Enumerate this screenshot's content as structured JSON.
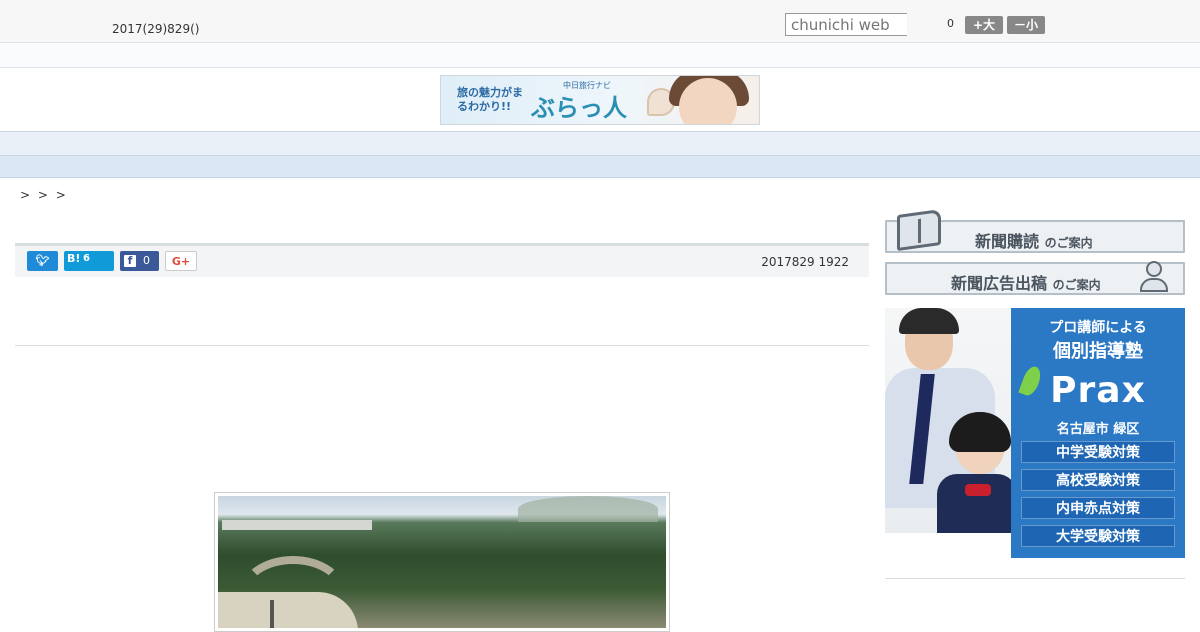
{
  "header": {
    "date": "2017(29)829()",
    "search_placeholder": "chunichi web",
    "counter": "0",
    "font_bigger": "+大",
    "font_smaller": "－小"
  },
  "banner": {
    "tagline": "旅の魅力がまるわかり!!",
    "subtitle": "中日旅行ナビ",
    "brand": "ぶらっ人"
  },
  "nav": {
    "items": [
      "　　",
      "　　",
      "　　",
      "　　",
      "　　",
      "　　",
      "　　",
      "　　",
      "　　"
    ]
  },
  "breadcrumb": "> > >",
  "share": {
    "hatena_icon": "B!",
    "hatena_count": "6",
    "facebook_count": "0",
    "google_plus": "G+"
  },
  "article": {
    "published": "2017829 1922"
  },
  "sidebar": {
    "subscribe": {
      "main": "新聞購読",
      "sub": "のご案内"
    },
    "advertise": {
      "main": "新聞広告出稿",
      "sub": "のご案内"
    },
    "ad": {
      "line1": "プロ講師による",
      "line2": "個別指導塾",
      "logo": "Prax",
      "area": "名古屋市 緑区",
      "courses": [
        "中学受験対策",
        "高校受験対策",
        "内申赤点対策",
        "大学受験対策"
      ]
    }
  },
  "colors": {
    "twitter": "#1f8ad8",
    "hatena": "#119ad8",
    "facebook": "#3b5998",
    "ad_blue": "#2b78c4"
  }
}
